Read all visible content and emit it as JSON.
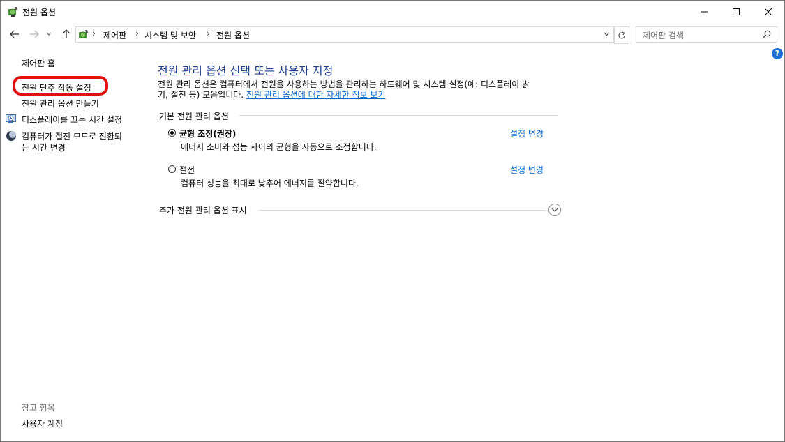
{
  "window": {
    "title": "전원 옵션"
  },
  "address": {
    "crumbs": [
      "제어판",
      "시스템 및 보안",
      "전원 옵션"
    ]
  },
  "search": {
    "placeholder": "제어판 검색"
  },
  "help": {
    "label": "?"
  },
  "left_pane": {
    "home": "제어판 홈",
    "links": [
      "전원 단추 작동 설정",
      "전원 관리 옵션 만들기",
      "디스플레이를 끄는 시간 설정",
      "컴퓨터가 절전 모드로 전환되",
      "는 시간 변경"
    ],
    "see_also_title": "참고 항목",
    "see_also_links": [
      "사용자 계정"
    ]
  },
  "main": {
    "title": "전원 관리 옵션 선택 또는 사용자 지정",
    "description_line1": "전원 관리 옵션은 컴퓨터에서 전원을 사용하는 방법을 관리하는 하드웨어 및 시스템 설정(예: 디스플레이 밝",
    "description_line2_prefix": "기, 절전 등) 모음입니다. ",
    "description_link": "전원 관리 옵션에 대한 자세한 정보 보기",
    "section_title": "기본 전원 관리 옵션",
    "plans": [
      {
        "name": "균형 조정(권장)",
        "description": "에너지 소비와 성능 사이의 균형을 자동으로 조정합니다.",
        "change_label": "설정 변경",
        "selected": true
      },
      {
        "name": "절전",
        "description": "컴퓨터 성능을 최대로 낮추어 에너지를 절약합니다.",
        "change_label": "설정 변경",
        "selected": false
      }
    ],
    "more_options": "추가 전원 관리 옵션 표시"
  },
  "colors": {
    "highlight": "#e20f0f",
    "link": "#0066cc",
    "title": "#1e3f8a"
  }
}
